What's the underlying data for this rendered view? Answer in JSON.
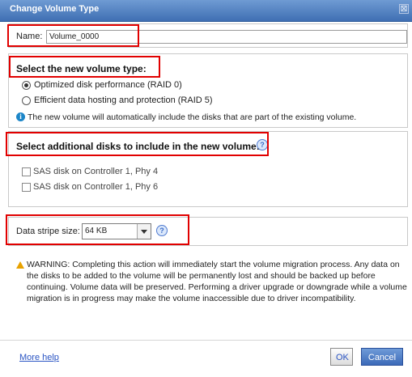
{
  "dialog": {
    "title": "Change Volume Type",
    "close_glyph": "⊠"
  },
  "name_field": {
    "label": "Name:",
    "value": "Volume_0000"
  },
  "volume_type": {
    "heading": "Select the new volume type:",
    "options": [
      {
        "label": "Optimized disk performance (RAID 0)",
        "selected": true
      },
      {
        "label": "Efficient data hosting and protection (RAID 5)",
        "selected": false
      }
    ],
    "info_text": "The new volume will automatically include the disks that are part of the existing volume."
  },
  "additional_disks": {
    "heading": "Select additional disks to include in the new volume:",
    "disks": [
      {
        "label": "SAS disk on Controller 1, Phy 4",
        "checked": false
      },
      {
        "label": "SAS disk on Controller 1, Phy 6",
        "checked": false
      }
    ]
  },
  "stripe": {
    "label": "Data stripe size:",
    "value": "64 KB"
  },
  "warning": {
    "text": "WARNING: Completing this action will immediately start the volume migration process. Any data on the disks to be added to the volume will be permanently lost and should be backed up before continuing. Volume data will be preserved. Performing a driver upgrade or downgrade while a volume migration is in progress may make the volume inaccessible due to driver incompatibility."
  },
  "footer": {
    "more_help": "More help",
    "ok": "OK",
    "cancel": "Cancel"
  },
  "icons": {
    "info": "info-icon",
    "help": "help-icon",
    "warning": "warning-icon"
  },
  "colors": {
    "titlebar": "#3f6fb3",
    "highlight": "#e10000",
    "link": "#2a54c3",
    "cancel_button": "#3c6ab8"
  }
}
